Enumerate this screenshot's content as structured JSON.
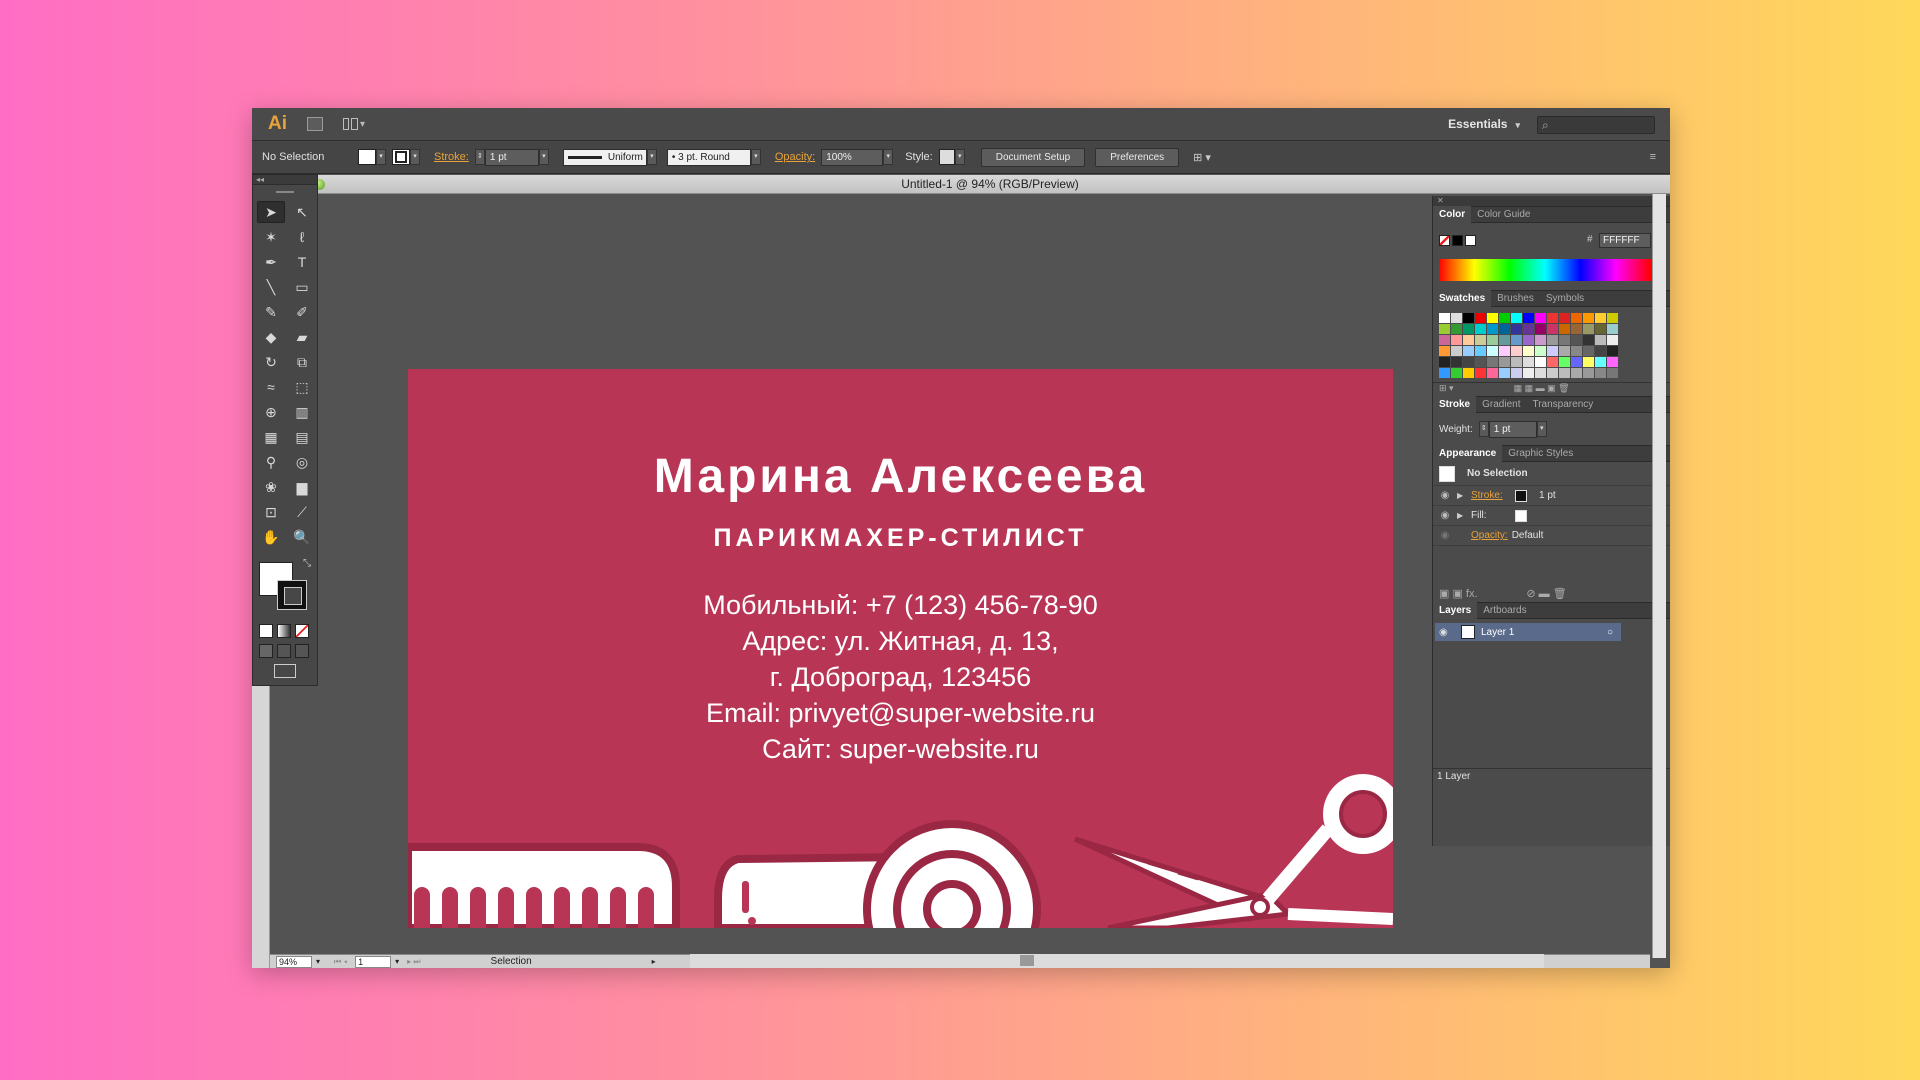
{
  "app": {
    "logo": "Ai",
    "workspace": "Essentials",
    "search_placeholder": ""
  },
  "control_bar": {
    "selection_label": "No Selection",
    "stroke_label": "Stroke:",
    "stroke_weight": "1 pt",
    "stroke_profile": "Uniform",
    "brush": "3 pt. Round",
    "opacity_label": "Opacity:",
    "opacity_value": "100%",
    "style_label": "Style:",
    "document_setup": "Document Setup",
    "preferences": "Preferences"
  },
  "document": {
    "tab_title": "Untitled-1 @ 94% (RGB/Preview)"
  },
  "business_card": {
    "name": "Марина Алексеева",
    "profession": "ПАРИКМАХЕР-СТИЛИСТ",
    "lines": [
      "Мобильный: +7 (123) 456-78-90",
      "Адрес: ул. Житная, д. 13,",
      "г. Доброград, 123456",
      "Email: privyet@super-website.ru",
      "Сайт: super-website.ru"
    ],
    "background_color": "#b83555",
    "art_icons": [
      "comb-icon",
      "hair-dryer-icon",
      "scissors-icon"
    ]
  },
  "panels": {
    "color": {
      "tabs": [
        "Color",
        "Color Guide"
      ],
      "hex": "FFFFFF"
    },
    "swatches": {
      "tabs": [
        "Swatches",
        "Brushes",
        "Symbols"
      ]
    },
    "stroke": {
      "tabs": [
        "Stroke",
        "Gradient",
        "Transparency"
      ],
      "weight_label": "Weight:",
      "weight_value": "1 pt"
    },
    "appearance": {
      "tabs": [
        "Appearance",
        "Graphic Styles"
      ],
      "header": "No Selection",
      "stroke_label": "Stroke:",
      "stroke_value": "1 pt",
      "fill_label": "Fill:",
      "opacity_label": "Opacity:",
      "opacity_value": "Default"
    },
    "layers": {
      "tabs": [
        "Layers",
        "Artboards"
      ],
      "layer_name": "Layer 1",
      "count": "1 Layer"
    }
  },
  "status_bar": {
    "zoom": "94%",
    "artboard": "1",
    "tool": "Selection"
  }
}
